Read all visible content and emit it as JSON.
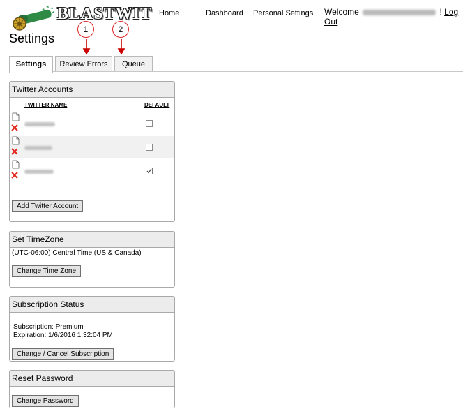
{
  "header": {
    "logo_text": "BLASTWIT",
    "nav": {
      "home": "Home",
      "dashboard": "Dashboard",
      "personal_settings": "Personal Settings"
    },
    "welcome_label": "Welcome",
    "separator": "!",
    "logout_label": "Log Out"
  },
  "page_title": "Settings",
  "tabs": [
    {
      "label": "Settings",
      "active": true
    },
    {
      "label": "Review Errors",
      "active": false
    },
    {
      "label": "Queue",
      "active": false
    }
  ],
  "callouts": [
    "1",
    "2"
  ],
  "twitter_accounts": {
    "title": "Twitter Accounts",
    "col_name": "TWITTER NAME",
    "col_default": "DEFAULT",
    "rows": [
      {
        "default": false
      },
      {
        "default": false
      },
      {
        "default": true
      }
    ],
    "add_button": "Add Twitter Account"
  },
  "timezone": {
    "title": "Set TimeZone",
    "value": "(UTC-06:00) Central Time (US & Canada)",
    "button": "Change Time Zone"
  },
  "subscription": {
    "title": "Subscription Status",
    "line1": "Subscription: Premium",
    "line2": "Expiration: 1/6/2016 1:32:04 PM",
    "button": "Change / Cancel Subscription"
  },
  "reset_password": {
    "title": "Reset Password",
    "button": "Change Password"
  },
  "colors": {
    "callout_border": "#dd2222",
    "arrow": "#cc0000",
    "logo_green": "#3a9a5a"
  },
  "icons": [
    "cannon-logo-icon",
    "document-icon",
    "delete-x-icon",
    "checkbox-icon",
    "down-arrow-icon"
  ]
}
